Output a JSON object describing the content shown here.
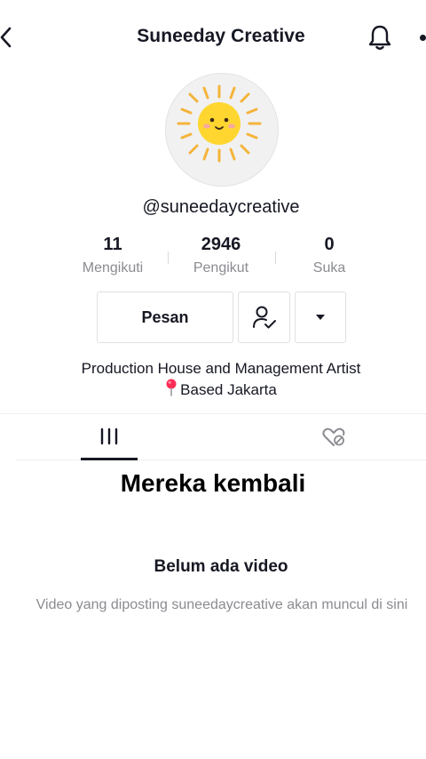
{
  "header": {
    "title": "Suneeday Creative",
    "back_icon": "chevron-left-icon",
    "notification_icon": "bell-icon",
    "more_icon": "more-dots-icon"
  },
  "profile": {
    "avatar": "sun-logo-avatar",
    "username": "@suneedaycreative",
    "stats": [
      {
        "value": "11",
        "label": "Mengikuti"
      },
      {
        "value": "2946",
        "label": "Pengikut"
      },
      {
        "value": "0",
        "label": "Suka"
      }
    ],
    "buttons": {
      "message_label": "Pesan",
      "following_icon": "user-check-icon",
      "dropdown_icon": "caret-down-icon"
    },
    "bio": {
      "line1": "Production House and Management Artist",
      "line2": "Based Jakarta",
      "line2_icon": "pin-icon"
    }
  },
  "tabs": {
    "videos_icon": "grid-bars-icon",
    "liked_icon": "hidden-heart-icon",
    "active": "videos"
  },
  "overlay_text": "Mereka kembali",
  "empty_state": {
    "title": "Belum ada video",
    "description": "Video yang diposting suneedaycreative akan muncul di sini"
  },
  "colors": {
    "text_primary": "#161823",
    "text_secondary": "#8a8b91",
    "border": "#e1e1e4",
    "pin": "#fe2c55"
  }
}
